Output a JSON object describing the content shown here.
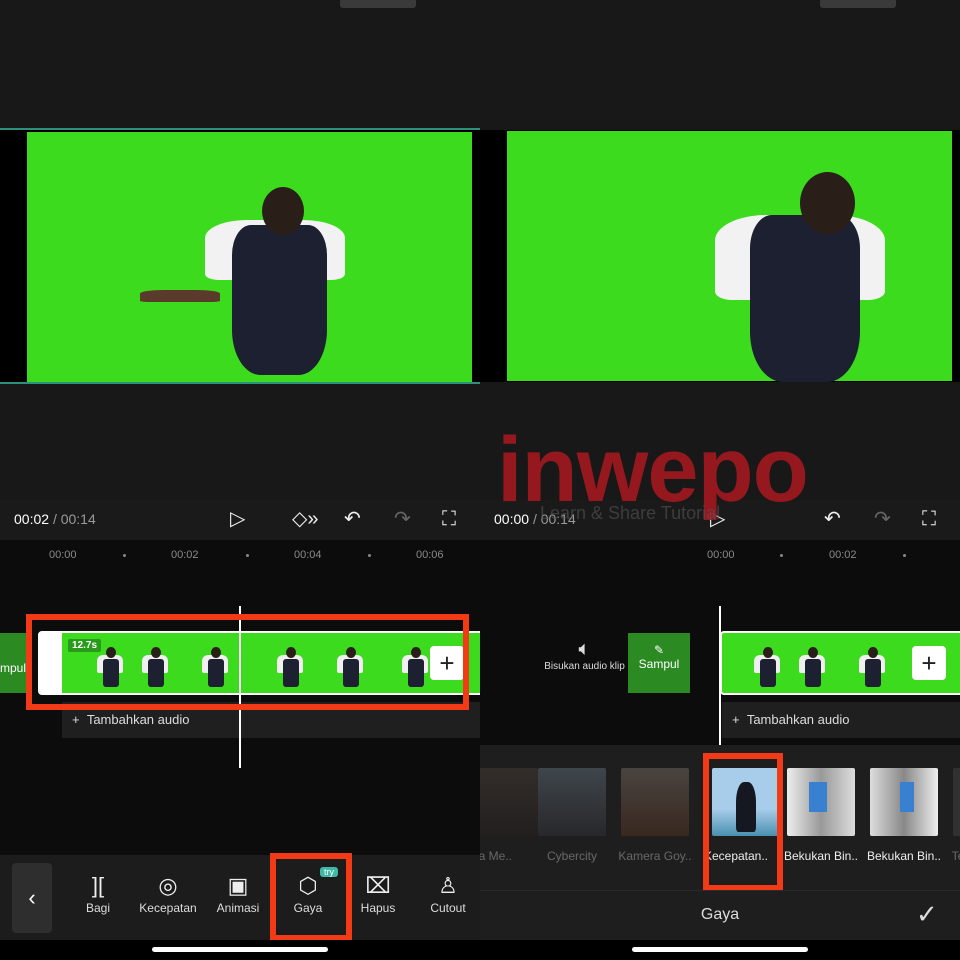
{
  "left": {
    "time_current": "00:02",
    "time_total": "/ 00:14",
    "ruler": [
      "00:00",
      "00:02",
      "00:04",
      "00:06"
    ],
    "clip_duration": "12.7s",
    "cover_label": "mpul",
    "add_audio": "Tambahkan audio",
    "toolbar": [
      {
        "label": "Bagi",
        "icon": "split-icon"
      },
      {
        "label": "Kecepatan",
        "icon": "speed-icon"
      },
      {
        "label": "Animasi",
        "icon": "animation-icon"
      },
      {
        "label": "Gaya",
        "icon": "cube-icon",
        "badge": "try"
      },
      {
        "label": "Hapus",
        "icon": "delete-icon"
      },
      {
        "label": "Cutout",
        "icon": "cutout-icon"
      }
    ]
  },
  "right": {
    "time_current": "00:00",
    "time_total": "/ 00:14",
    "ruler": [
      "00:00",
      "00:02"
    ],
    "mute_label": "Bisukan audio klip",
    "cover_label": "Sampul",
    "add_audio": "Tambahkan audio",
    "effects": [
      {
        "label": "era Me..",
        "dim": true
      },
      {
        "label": "Cybercity",
        "dim": true
      },
      {
        "label": "Kamera Goy..",
        "dim": true
      },
      {
        "label": "Kecepatan..",
        "selected": true
      },
      {
        "label": "Bekukan Bin.."
      },
      {
        "label": "Bekukan Bin.."
      },
      {
        "label": "Te",
        "dim": true
      }
    ],
    "panel_title": "Gaya"
  },
  "watermark": {
    "brand": "inwepo",
    "tagline": "Learn & Share Tutorial"
  },
  "colors": {
    "highlight": "#f23a16",
    "chroma": "#3ddb1e",
    "watermark": "#a01820"
  }
}
